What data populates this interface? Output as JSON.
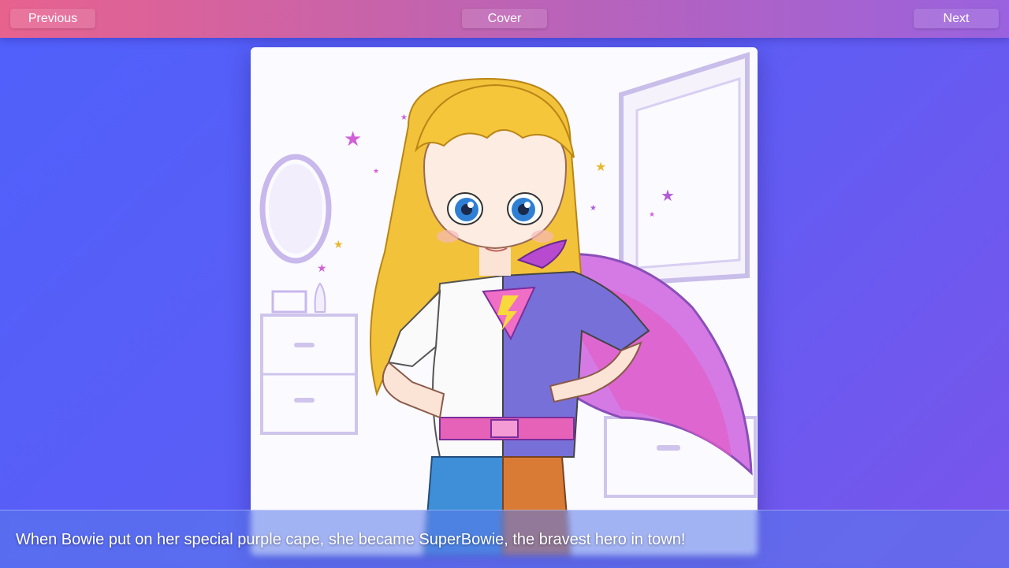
{
  "nav": {
    "previous_label": "Previous",
    "cover_label": "Cover",
    "next_label": "Next"
  },
  "page": {
    "caption": "When Bowie put on her special purple cape, she became SuperBowie, the bravest hero in town!"
  },
  "colors": {
    "accent_pink": "#e8628e",
    "accent_purple": "#9a62de",
    "background_blue": "#5060fb"
  }
}
